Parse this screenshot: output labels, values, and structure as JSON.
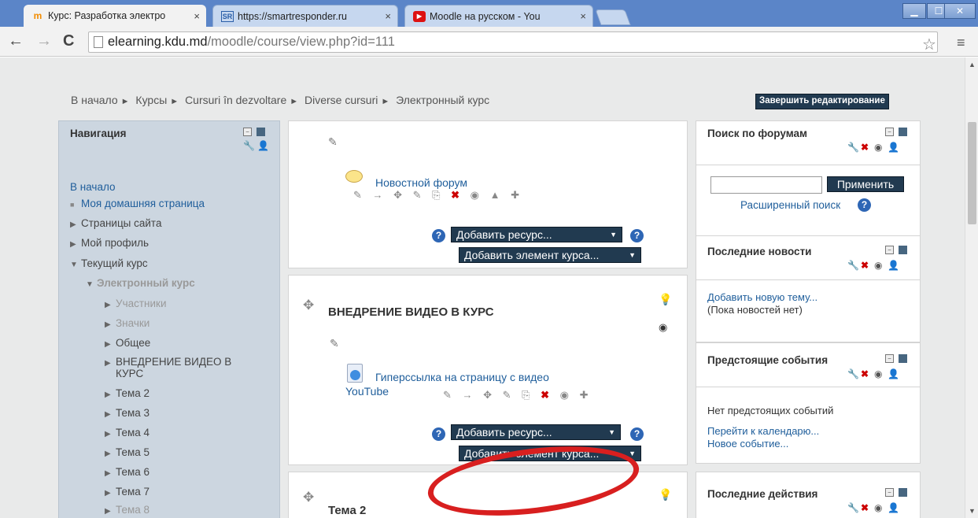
{
  "browser": {
    "tabs": [
      {
        "label": "Курс: Разработка электро",
        "icon": "moodle-favicon",
        "active": true
      },
      {
        "label": "https://smartresponder.ru",
        "icon": "sr-favicon",
        "active": false
      },
      {
        "label": "Moodle на русском - You",
        "icon": "youtube-favicon",
        "active": false
      }
    ],
    "url_host": "elearning.kdu.md",
    "url_path": "/moodle/course/view.php?id=111",
    "win_controls": {
      "minimize": "▁",
      "maximize": "☐",
      "close": "✕"
    },
    "star_glyph": "☆",
    "menu_glyph": "≡"
  },
  "breadcrumb": {
    "items": [
      "В начало",
      "Курсы",
      "Cursuri în dezvoltare",
      "Diverse cursuri",
      "Электронный курс"
    ],
    "sep": "►"
  },
  "finish_editing_label": "Завершить редактирование",
  "navigation": {
    "title": "Навигация",
    "items": [
      {
        "label": "В начало",
        "style": "link",
        "marker": "none",
        "indent": 0
      },
      {
        "label": "Моя домашняя страница",
        "style": "link",
        "marker": "bullet",
        "indent": 0
      },
      {
        "label": "Страницы сайта",
        "style": "dark",
        "marker": "right",
        "indent": 0
      },
      {
        "label": "Мой профиль",
        "style": "dark",
        "marker": "right",
        "indent": 0
      },
      {
        "label": "Текущий курс",
        "style": "dark",
        "marker": "down",
        "indent": 0
      },
      {
        "label": "Электронный курс",
        "style": "grey-bold",
        "marker": "down",
        "indent": 1
      },
      {
        "label": "Участники",
        "style": "grey",
        "marker": "right",
        "indent": 2
      },
      {
        "label": "Значки",
        "style": "grey",
        "marker": "right",
        "indent": 2
      },
      {
        "label": "Общее",
        "style": "dark",
        "marker": "right",
        "indent": 2
      },
      {
        "label": "ВНЕДРЕНИЕ ВИДЕО В",
        "style": "dark",
        "marker": "right",
        "indent": 2
      },
      {
        "label": "КУРС",
        "style": "dark",
        "marker": "none",
        "indent": 2
      },
      {
        "label": "Тема 2",
        "style": "dark",
        "marker": "right",
        "indent": 2
      },
      {
        "label": "Тема 3",
        "style": "dark",
        "marker": "right",
        "indent": 2
      },
      {
        "label": "Тема 4",
        "style": "dark",
        "marker": "right",
        "indent": 2
      },
      {
        "label": "Тема 5",
        "style": "dark",
        "marker": "right",
        "indent": 2
      },
      {
        "label": "Тема 6",
        "style": "dark",
        "marker": "right",
        "indent": 2
      },
      {
        "label": "Тема 7",
        "style": "dark",
        "marker": "right",
        "indent": 2
      },
      {
        "label": "Тема 8",
        "style": "grey",
        "marker": "right",
        "indent": 2
      }
    ]
  },
  "sections": {
    "general": {
      "forum_link": "Новостной форум",
      "add_resource": "Добавить ресурс...",
      "add_activity": "Добавить элемент курса..."
    },
    "video": {
      "title": "ВНЕДРЕНИЕ ВИДЕО В КУРС",
      "link_line1": "Гиперссылка на страницу с видео",
      "link_line2": "YouTube",
      "add_resource": "Добавить ресурс...",
      "add_activity": "Добавить элемент курса..."
    },
    "topic2": {
      "title": "Тема 2"
    }
  },
  "forum_search": {
    "title": "Поиск по форумам",
    "input_value": "",
    "apply_button": "Применить",
    "advanced_link": "Расширенный поиск"
  },
  "latest_news": {
    "title": "Последние новости",
    "add_topic": "Добавить новую тему...",
    "empty": "(Пока новостей нет)"
  },
  "upcoming_events": {
    "title": "Предстоящие события",
    "empty": "Нет предстоящих событий",
    "goto_calendar": "Перейти к календарю...",
    "new_event": "Новое событие..."
  },
  "recent_activity": {
    "title": "Последние действия"
  },
  "help_glyph": "?",
  "highlight_color": "#d81f1f"
}
